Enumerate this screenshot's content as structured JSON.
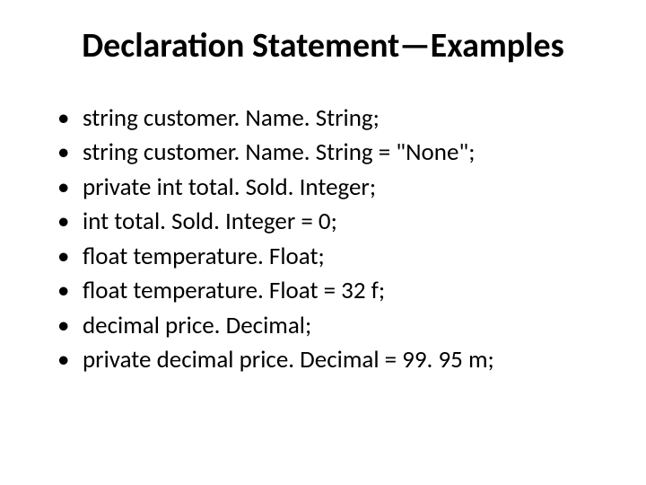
{
  "title": "Declaration Statement—Examples",
  "examples": [
    "string customer. Name. String;",
    "string customer. Name. String = \"None\";",
    "private int total. Sold. Integer;",
    "int total. Sold. Integer = 0;",
    "float temperature. Float;",
    "float temperature. Float = 32 f;",
    "decimal price. Decimal;",
    "private decimal price. Decimal = 99. 95 m;"
  ]
}
